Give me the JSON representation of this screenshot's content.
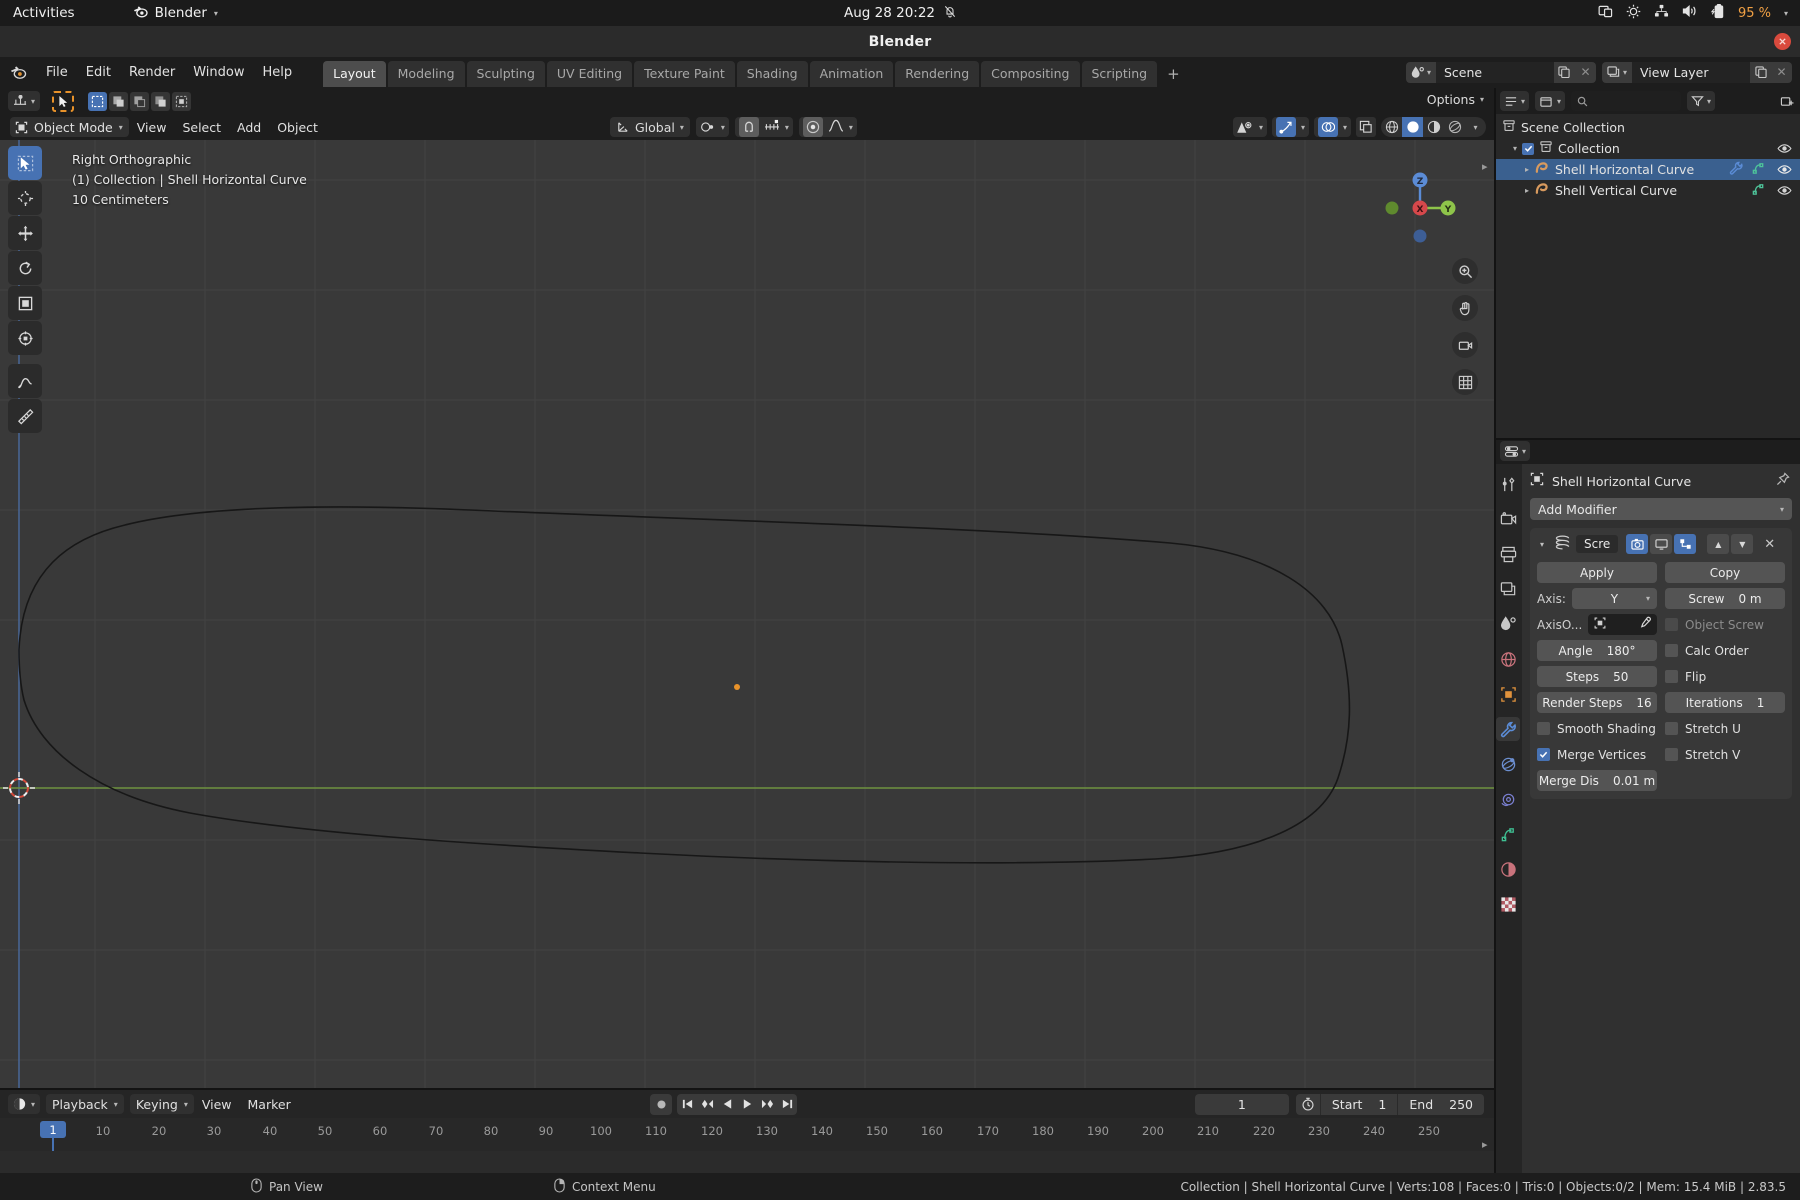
{
  "gnome": {
    "activities": "Activities",
    "app_name": "Blender",
    "clock": "Aug 28  20:22",
    "battery_pct": "95 %",
    "tray_icons": [
      "screencast-icon",
      "brightness-icon",
      "network-icon",
      "volume-icon",
      "battery-icon",
      "chevron-down-icon"
    ]
  },
  "window": {
    "title": "Blender",
    "close_label": "×"
  },
  "topbar": {
    "menus": [
      "File",
      "Edit",
      "Render",
      "Window",
      "Help"
    ],
    "workspaces": [
      "Layout",
      "Modeling",
      "Sculpting",
      "UV Editing",
      "Texture Paint",
      "Shading",
      "Animation",
      "Rendering",
      "Compositing",
      "Scripting"
    ],
    "active_workspace": "Layout",
    "add_workspace": "+",
    "scene_name": "Scene",
    "view_layer_name": "View Layer"
  },
  "viewport": {
    "mode": "Object Mode",
    "menus": [
      "View",
      "Select",
      "Add",
      "Object"
    ],
    "orientation": "Global",
    "options_label": "Options",
    "overlay_line1": "Right Orthographic",
    "overlay_line2": "(1) Collection | Shell Horizontal Curve",
    "overlay_line3": "10 Centimeters",
    "gizmo_axes": [
      {
        "label": "Z",
        "color": "#5b8cd6"
      },
      {
        "label": "X",
        "color": "#d6484b"
      },
      {
        "label": "Y",
        "color": "#8ec44a"
      }
    ],
    "nav_tools": [
      "zoom-icon",
      "hand-icon",
      "camera-icon",
      "grid-icon"
    ],
    "tools": [
      "select-box-tool",
      "cursor-tool",
      "move-tool",
      "rotate-tool",
      "scale-tool",
      "transform-tool",
      "annotate-tool",
      "measure-tool"
    ]
  },
  "outliner": {
    "search_placeholder": "",
    "rows": [
      {
        "label": "Scene Collection",
        "icon": "collection-icon",
        "indent": 0,
        "selected": false,
        "has_eye": false,
        "expand": "",
        "checkbox": false,
        "modifiers": []
      },
      {
        "label": "Collection",
        "icon": "collection-icon",
        "indent": 1,
        "selected": false,
        "has_eye": true,
        "expand": "▾",
        "checkbox": true,
        "modifiers": []
      },
      {
        "label": "Shell Horizontal Curve",
        "icon": "curve-icon",
        "indent": 2,
        "selected": true,
        "has_eye": true,
        "expand": "▸",
        "checkbox": false,
        "modifiers": [
          "wrench-icon",
          "curve-data-icon"
        ]
      },
      {
        "label": "Shell Vertical Curve",
        "icon": "curve-icon",
        "indent": 2,
        "selected": false,
        "has_eye": true,
        "expand": "▸",
        "checkbox": false,
        "modifiers": [
          "curve-data-icon"
        ]
      }
    ]
  },
  "properties": {
    "breadcrumb_object": "Shell Horizontal Curve",
    "add_modifier_label": "Add Modifier",
    "tabs": [
      "tool-icon",
      "render-icon",
      "output-icon",
      "view-layer-icon",
      "scene-icon",
      "world-icon",
      "object-icon",
      "modifier-icon",
      "physics-icon",
      "constraint-icon",
      "data-icon",
      "material-icon",
      "texture-icon"
    ],
    "active_tab": "modifier-icon",
    "modifier": {
      "name": "Scre",
      "apply_label": "Apply",
      "copy_label": "Copy",
      "axis_label": "Axis:",
      "axis_value": "Y",
      "axis_object_label": "AxisO...",
      "angle_label": "Angle",
      "angle_value": "180°",
      "steps_label": "Steps",
      "steps_value": "50",
      "render_steps_label": "Render Steps",
      "render_steps_value": "16",
      "smooth_shading_label": "Smooth Shading",
      "smooth_shading_checked": false,
      "merge_vertices_label": "Merge Vertices",
      "merge_vertices_checked": true,
      "merge_dist_label": "Merge Dis",
      "merge_dist_value": "0.01 m",
      "screw_label": "Screw",
      "screw_value": "0 m",
      "object_screw_label": "Object Screw",
      "object_screw_checked": false,
      "calc_order_label": "Calc Order",
      "calc_order_checked": false,
      "flip_label": "Flip",
      "flip_checked": false,
      "iterations_label": "Iterations",
      "iterations_value": "1",
      "stretch_u_label": "Stretch U",
      "stretch_u_checked": false,
      "stretch_v_label": "Stretch V",
      "stretch_v_checked": false
    }
  },
  "timeline": {
    "dropdowns": [
      "Playback",
      "Keying"
    ],
    "menus": [
      "View",
      "Marker"
    ],
    "current_frame": "1",
    "start_label": "Start",
    "start_value": "1",
    "end_label": "End",
    "end_value": "250",
    "ticks": [
      "10",
      "20",
      "30",
      "40",
      "50",
      "60",
      "70",
      "80",
      "90",
      "100",
      "110",
      "120",
      "130",
      "140",
      "150",
      "160",
      "170",
      "180",
      "190",
      "200",
      "210",
      "220",
      "230",
      "240",
      "250"
    ],
    "playhead_frame": "1"
  },
  "statusbar": {
    "pan_view": "Pan View",
    "context_menu": "Context Menu",
    "stats": "Collection | Shell Horizontal Curve | Verts:108 | Faces:0 | Tris:0 | Objects:0/2 | Mem: 15.4 MiB | 2.83.5"
  },
  "colors": {
    "accent_blue": "#4772b3",
    "selection_orange": "#e8922a",
    "axis_green": "#8ec44a",
    "axis_red": "#d6484b",
    "axis_blue": "#5b8cd6",
    "curve_stroke": "#1a1a1a"
  }
}
